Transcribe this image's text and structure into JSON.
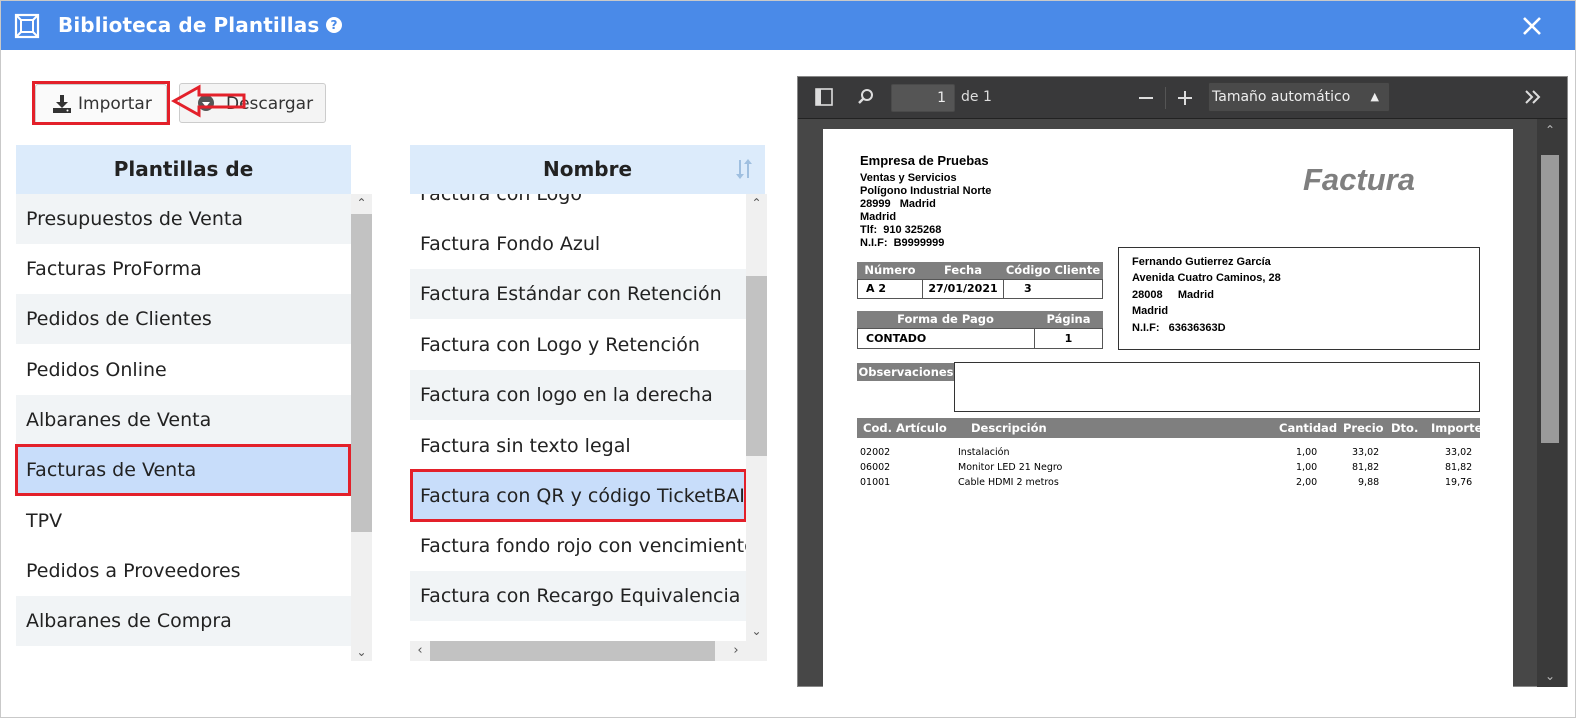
{
  "window": {
    "title": "Biblioteca de Plantillas",
    "help": "?"
  },
  "toolbar": {
    "import_label": "Importar",
    "download_label": "Descargar"
  },
  "left_panel": {
    "header": "Plantillas de",
    "items": [
      "Presupuestos de Venta",
      "Facturas ProForma",
      "Pedidos de Clientes",
      "Pedidos Online",
      "Albaranes de Venta",
      "Facturas de Venta",
      "TPV",
      "Pedidos a Proveedores",
      "Albaranes de Compra"
    ],
    "selected_index": 5
  },
  "middle_panel": {
    "header": "Nombre",
    "items": [
      "Factura con Logo",
      "Factura Fondo Azul",
      "Factura Estándar con Retención",
      "Factura con Logo y Retención",
      "Factura con logo en la derecha",
      "Factura sin texto legal",
      "Factura con QR y código TicketBAI",
      "Factura fondo rojo con vencimiento",
      "Factura con Recargo Equivalencia"
    ],
    "selected_index": 6
  },
  "pdf_viewer": {
    "page_number": "1",
    "page_of": "de 1",
    "zoom": "Tamaño automático"
  },
  "invoice": {
    "company_name": "Empresa de Pruebas",
    "company_lines": [
      "Ventas y Servicios",
      "Polígono Industrial Norte",
      "28999   Madrid",
      "Madrid",
      "Tlf:  910 325268",
      "N.I.F:  B9999999"
    ],
    "doc_title": "Factura",
    "meta_headers": [
      "Número",
      "Fecha",
      "Código Cliente"
    ],
    "meta_values": [
      "A 2",
      "27/01/2021",
      "3"
    ],
    "pay_headers": [
      "Forma de Pago",
      "Página"
    ],
    "pay_values": [
      "CONTADO",
      "1"
    ],
    "client_lines": [
      "Fernando Gutierrez García",
      "Avenida Cuatro Caminos, 28",
      "28008     Madrid",
      "Madrid",
      "N.I.F:   63636363D"
    ],
    "observaciones_label": "Observaciones",
    "table_headers": [
      "Cod. Artículo",
      "Descripción",
      "Cantidad",
      "Precio",
      "Dto.",
      "Importe"
    ],
    "lines": [
      {
        "code": "02002",
        "desc": "Instalación",
        "qty": "1,00",
        "price": "33,02",
        "dto": "",
        "total": "33,02"
      },
      {
        "code": "06002",
        "desc": "Monitor LED 21 Negro",
        "qty": "1,00",
        "price": "81,82",
        "dto": "",
        "total": "81,82"
      },
      {
        "code": "01001",
        "desc": "Cable HDMI 2 metros",
        "qty": "2,00",
        "price": "9,88",
        "dto": "",
        "total": "19,76"
      }
    ]
  },
  "colors": {
    "titlebar": "#4a8ae8",
    "highlight": "#e3202a",
    "selected_row": "#c8ddfa",
    "header_bg": "#dcebfb"
  }
}
